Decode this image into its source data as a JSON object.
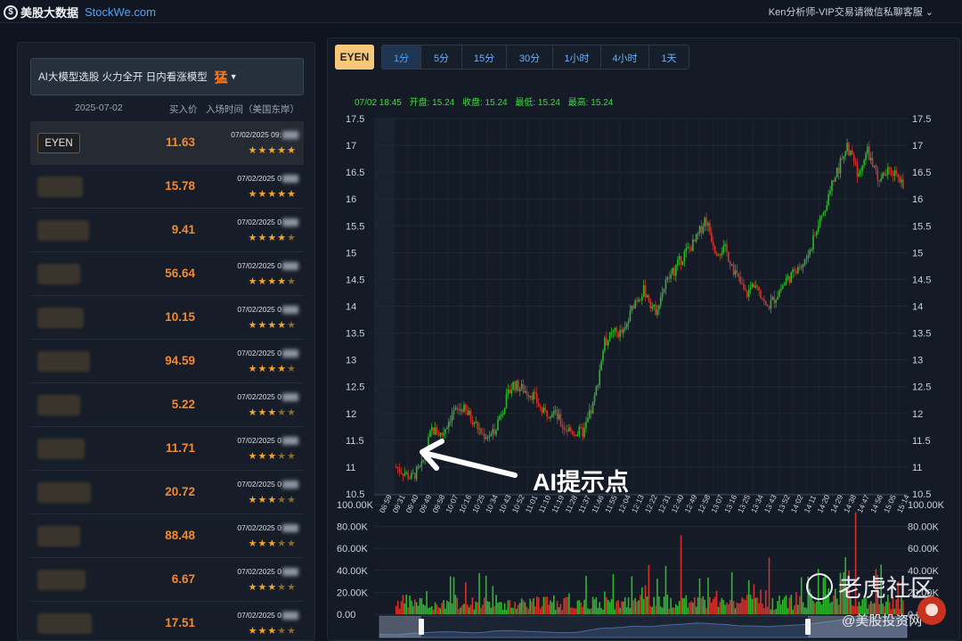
{
  "header": {
    "brand": "美股大数据",
    "site": "StockWe.com",
    "user_menu": "Ken分析师-VIP交易请微信私聊客服"
  },
  "model_selector": {
    "label": "AI大模型选股 火力全开 日内看涨模型",
    "mode": "猛"
  },
  "list": {
    "date": "2025-07-02",
    "col_price": "买入价",
    "col_time": "入场时间（美国东岸）",
    "rows": [
      {
        "ticker": "EYEN",
        "price": "11.63",
        "time": "07/02/2025 09:",
        "stars": 5,
        "blurred": false,
        "active": true
      },
      {
        "ticker": "",
        "price": "15.78",
        "time": "07/02/2025 0",
        "stars": 5,
        "blurred": true
      },
      {
        "ticker": "",
        "price": "9.41",
        "time": "07/02/2025 0",
        "stars": 4,
        "blurred": true
      },
      {
        "ticker": "",
        "price": "56.64",
        "time": "07/02/2025 0",
        "stars": 4,
        "blurred": true
      },
      {
        "ticker": "",
        "price": "10.15",
        "time": "07/02/2025 0",
        "stars": 4,
        "blurred": true
      },
      {
        "ticker": "",
        "price": "94.59",
        "time": "07/02/2025 0",
        "stars": 4,
        "blurred": true
      },
      {
        "ticker": "",
        "price": "5.22",
        "time": "07/02/2025 0",
        "stars": 3,
        "blurred": true
      },
      {
        "ticker": "",
        "price": "11.71",
        "time": "07/02/2025 0",
        "stars": 3,
        "blurred": true
      },
      {
        "ticker": "",
        "price": "20.72",
        "time": "07/02/2025 0",
        "stars": 3,
        "blurred": true
      },
      {
        "ticker": "",
        "price": "88.48",
        "time": "07/02/2025 0",
        "stars": 3,
        "blurred": true
      },
      {
        "ticker": "",
        "price": "6.67",
        "time": "07/02/2025 0",
        "stars": 3,
        "blurred": true
      },
      {
        "ticker": "",
        "price": "17.51",
        "time": "07/02/2025 0",
        "stars": 3,
        "blurred": true
      }
    ]
  },
  "chart_panel": {
    "symbol": "EYEN",
    "timeframes": [
      "1分",
      "5分",
      "15分",
      "30分",
      "1小时",
      "4小时",
      "1天"
    ],
    "selected_timeframe": "1分",
    "info": {
      "datetime": "07/02 18:45",
      "open": "开盘: 15.24",
      "close": "收盘: 15.24",
      "low": "最低: 15.24",
      "high": "最高: 15.24"
    },
    "annotation": "AI提示点"
  },
  "watermark": {
    "community": "老虎社区",
    "account": "@美股投资网"
  },
  "colors": {
    "up": "#2fb52f",
    "down": "#d3322c",
    "accent": "#f28a2e",
    "star": "#f5a623",
    "link": "#4aa3ff"
  },
  "chart_data": {
    "type": "candlestick",
    "price_axis": {
      "ticks": [
        "10.5",
        "11",
        "11.5",
        "12",
        "12.5",
        "13",
        "13.5",
        "14",
        "14.5",
        "15",
        "15.5",
        "16",
        "16.5",
        "17",
        "17.5"
      ],
      "min": 10.5,
      "max": 17.5
    },
    "volume_axis": {
      "ticks": [
        "0.00",
        "20.00K",
        "40.00K",
        "60.00K",
        "80.00K",
        "100.00K"
      ],
      "min": 0,
      "max": 100000
    },
    "time_ticks": [
      "08:59",
      "09:31",
      "09:40",
      "09:49",
      "09:58",
      "10:07",
      "10:16",
      "10:25",
      "10:34",
      "10:43",
      "10:52",
      "11:01",
      "11:10",
      "11:19",
      "11:28",
      "11:37",
      "11:46",
      "11:55",
      "12:04",
      "12:13",
      "12:22",
      "12:31",
      "12:40",
      "12:49",
      "12:58",
      "13:07",
      "13:16",
      "13:25",
      "13:34",
      "13:43",
      "13:52",
      "14:02",
      "14:11",
      "14:20",
      "14:29",
      "14:38",
      "14:47",
      "14:56",
      "15:05",
      "15:14"
    ],
    "close_path": [
      [
        0,
        11.0
      ],
      [
        3,
        10.8
      ],
      [
        5,
        11.0
      ],
      [
        7,
        11.7
      ],
      [
        9,
        11.6
      ],
      [
        11,
        12.0
      ],
      [
        13,
        12.1
      ],
      [
        15,
        11.9
      ],
      [
        17,
        11.6
      ],
      [
        19,
        11.6
      ],
      [
        21,
        12.1
      ],
      [
        23,
        12.55
      ],
      [
        25,
        12.45
      ],
      [
        27,
        12.35
      ],
      [
        29,
        12.0
      ],
      [
        31,
        12.05
      ],
      [
        33,
        11.75
      ],
      [
        35,
        11.65
      ],
      [
        37,
        11.65
      ],
      [
        39,
        12.2
      ],
      [
        41,
        13.3
      ],
      [
        43,
        13.5
      ],
      [
        45,
        13.5
      ],
      [
        47,
        14.1
      ],
      [
        49,
        14.3
      ],
      [
        51,
        13.9
      ],
      [
        53,
        14.4
      ],
      [
        55,
        14.7
      ],
      [
        57,
        15.0
      ],
      [
        59,
        15.2
      ],
      [
        61,
        15.65
      ],
      [
        63,
        15.05
      ],
      [
        65,
        15.05
      ],
      [
        67,
        14.6
      ],
      [
        69,
        14.2
      ],
      [
        71,
        14.5
      ],
      [
        73,
        13.95
      ],
      [
        75,
        14.2
      ],
      [
        77,
        14.5
      ],
      [
        79,
        14.65
      ],
      [
        81,
        14.9
      ],
      [
        83,
        15.4
      ],
      [
        85,
        16.0
      ],
      [
        87,
        16.5
      ],
      [
        89,
        17.0
      ],
      [
        91,
        16.5
      ],
      [
        93,
        16.9
      ],
      [
        95,
        16.35
      ],
      [
        97,
        16.5
      ],
      [
        99,
        16.5
      ],
      [
        100,
        16.2
      ]
    ]
  }
}
